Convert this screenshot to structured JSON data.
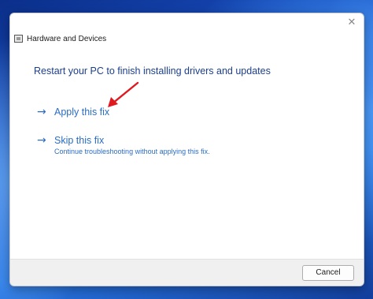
{
  "window": {
    "title": "Hardware and Devices",
    "close_glyph": "✕"
  },
  "main": {
    "heading": "Restart your PC to finish installing drivers and updates",
    "options": [
      {
        "arrow": "→",
        "label": "Apply this fix",
        "description": ""
      },
      {
        "arrow": "→",
        "label": "Skip this fix",
        "description": "Continue troubleshooting without applying this fix."
      }
    ],
    "annotation": {
      "icon": "red-pointer-arrow-icon",
      "color": "#e0191f"
    }
  },
  "footer": {
    "cancel_label": "Cancel"
  },
  "colors": {
    "link": "#2a6dc4",
    "heading": "#1c3f8c"
  }
}
